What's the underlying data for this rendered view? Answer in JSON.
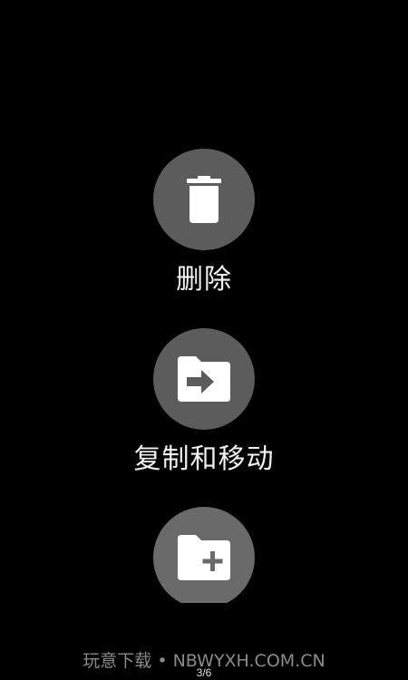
{
  "actions": [
    {
      "label": "删除",
      "icon": "trash-icon"
    },
    {
      "label": "复制和移动",
      "icon": "folder-move-icon"
    },
    {
      "label": "",
      "icon": "folder-add-icon"
    }
  ],
  "watermark": "玩意下载 • NBWYXH.COM.CN",
  "page_indicator": "3/6",
  "colors": {
    "background": "#000000",
    "circle": "#5c5c5c",
    "icon": "#ffffff",
    "label": "#f2f2f2"
  }
}
